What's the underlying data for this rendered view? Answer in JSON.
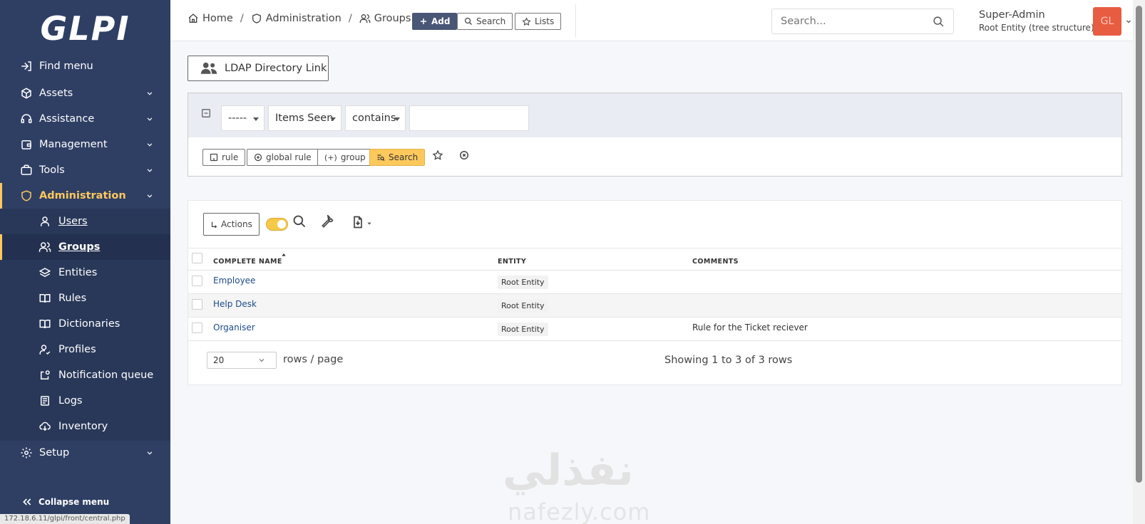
{
  "app": {
    "logo_text": "GLPI",
    "status_url": "172.18.6.11/glpi/front/central.php"
  },
  "colors": {
    "sidebar_bg": "#2f3f64",
    "accent": "#fec95c",
    "avatar_bg": "#e85c41",
    "primary_button": "#4a5676"
  },
  "sidebar": {
    "menu": [
      {
        "label": "Find menu",
        "icon": "arrow-right-icon"
      },
      {
        "label": "Assets",
        "icon": "package-icon"
      },
      {
        "label": "Assistance",
        "icon": "headset-icon"
      },
      {
        "label": "Management",
        "icon": "wallet-icon"
      },
      {
        "label": "Tools",
        "icon": "briefcase-icon"
      },
      {
        "label": "Administration",
        "icon": "shield-icon"
      },
      {
        "label": "Setup",
        "icon": "gear-icon"
      }
    ],
    "submenu": [
      {
        "label": "Users",
        "icon": "user-icon"
      },
      {
        "label": "Groups",
        "icon": "users-icon"
      },
      {
        "label": "Entities",
        "icon": "stack-icon"
      },
      {
        "label": "Rules",
        "icon": "book-icon"
      },
      {
        "label": "Dictionaries",
        "icon": "book-open-icon"
      },
      {
        "label": "Profiles",
        "icon": "user-check-icon"
      },
      {
        "label": "Notification queue",
        "icon": "notification-icon"
      },
      {
        "label": "Logs",
        "icon": "news-icon"
      },
      {
        "label": "Inventory",
        "icon": "cloud-download-icon"
      }
    ],
    "collapse_label": "Collapse menu"
  },
  "header": {
    "breadcrumb": [
      "Home",
      "Administration",
      "Groups"
    ],
    "buttons": {
      "add": "Add",
      "search": "Search",
      "lists": "Lists"
    },
    "search_placeholder": "Search...",
    "user_name": "Super-Admin",
    "user_entity": "Root Entity (tree structure)",
    "avatar_initials": "GL"
  },
  "main": {
    "ldap_button": "LDAP Directory Link",
    "search_criteria": {
      "field1": "-----",
      "field2": "Items Seen",
      "operator": "contains",
      "value": ""
    },
    "criteria_buttons": {
      "rule": "rule",
      "global_rule": "global rule",
      "group": "group",
      "search": "Search"
    },
    "actions_label": "Actions",
    "columns": [
      "COMPLETE NAME",
      "ENTITY",
      "COMMENTS"
    ],
    "rows": [
      {
        "name": "Employee",
        "entity": "Root Entity",
        "comment": ""
      },
      {
        "name": "Help Desk",
        "entity": "Root Entity",
        "comment": ""
      },
      {
        "name": "Organiser",
        "entity": "Root Entity",
        "comment": "Rule for the Ticket reciever"
      }
    ],
    "per_page": "20",
    "per_page_label": "rows / page",
    "showing": "Showing 1 to 3 of 3 rows"
  },
  "watermark": {
    "arabic": "نفذلي",
    "latin": "nafezly.com"
  }
}
